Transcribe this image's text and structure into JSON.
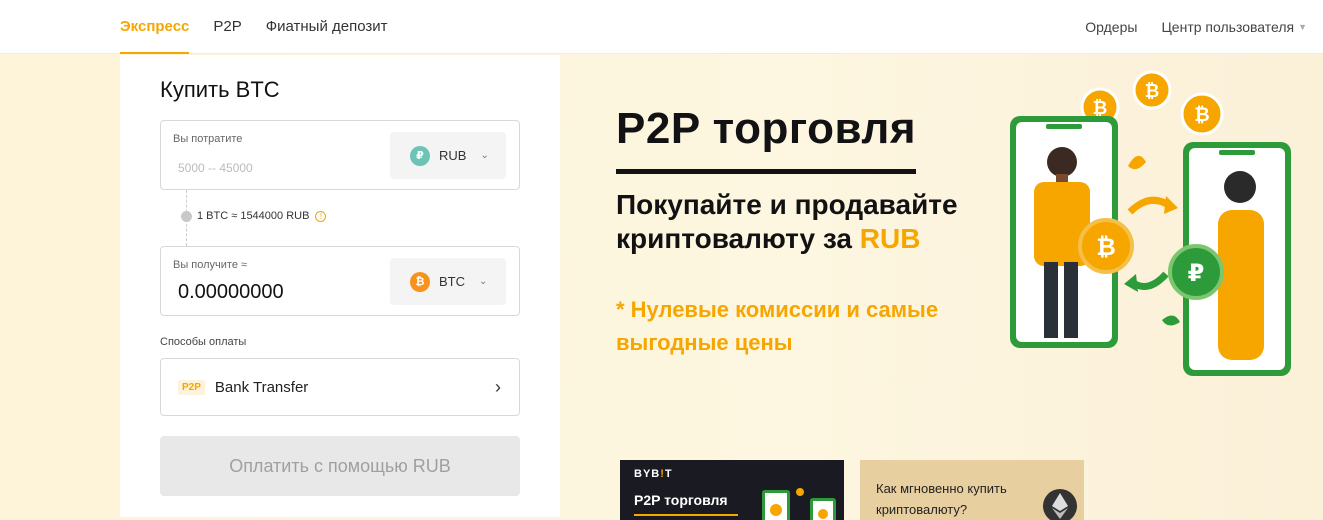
{
  "nav": {
    "tabs": [
      {
        "label": "Экспресс",
        "active": true
      },
      {
        "label": "P2P",
        "active": false
      },
      {
        "label": "Фиатный депозит",
        "active": false
      }
    ],
    "orders_label": "Ордеры",
    "user_center_label": "Центр пользователя"
  },
  "buy": {
    "title": "Купить BTC",
    "spend": {
      "label": "Вы потратите",
      "placeholder": "5000 -- 45000",
      "currency": "RUB",
      "currency_icon": "₽"
    },
    "rate": "1 BTC ≈ 1544000 RUB",
    "receive": {
      "label": "Вы получите ≈",
      "value": "0.00000000",
      "currency": "BTC",
      "currency_icon": "₿"
    },
    "payment_methods_label": "Способы оплаты",
    "payment_method": {
      "badge": "P2P",
      "name": "Bank Transfer"
    },
    "submit_label": "Оплатить с помощью RUB"
  },
  "hero": {
    "title": "P2P торговля",
    "subtitle_main": "Покупайте и продавайте криптовалюту за ",
    "subtitle_accent": "RUB",
    "note": "* Нулевые комиссии и самые выгодные цены"
  },
  "cards": {
    "dark": {
      "logo_a": "BYB",
      "logo_dot": "!",
      "logo_b": "T",
      "title": "P2P торговля"
    },
    "light": {
      "text": "Как мгновенно купить криптовалюту?"
    }
  },
  "colors": {
    "accent": "#f7a600",
    "dark": "#121214",
    "phone_green": "#2e9b3a"
  }
}
